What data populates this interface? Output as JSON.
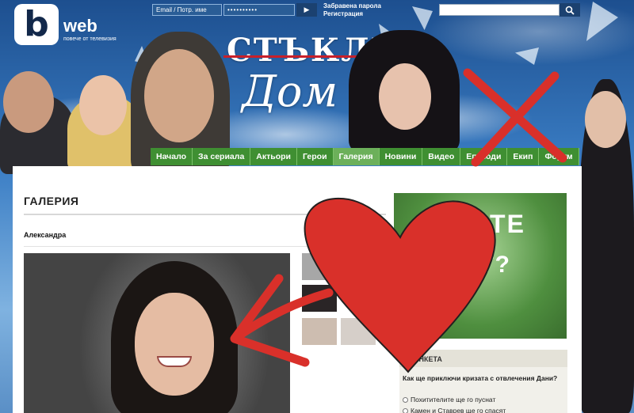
{
  "brand": {
    "logo_letter": "b",
    "logo_web": "web",
    "tagline": "повече от телевизия"
  },
  "login": {
    "username_placeholder": "Email / Потр. име",
    "password_value": "••••••••••",
    "forgot_label": "Забравена парола",
    "register_label": "Регистрация"
  },
  "search": {
    "placeholder": ""
  },
  "show": {
    "title_line1": "СТЪКЛЕН",
    "title_line2": "Дом"
  },
  "nav": {
    "items": [
      {
        "label": "Начало"
      },
      {
        "label": "За сериала"
      },
      {
        "label": "Актьори"
      },
      {
        "label": "Герои"
      },
      {
        "label": "Галерия"
      },
      {
        "label": "Новини"
      },
      {
        "label": "Видео"
      },
      {
        "label": "Епизоди"
      },
      {
        "label": "Екип"
      },
      {
        "label": "Форум"
      }
    ],
    "active_index": 4
  },
  "gallery": {
    "title": "ГАЛЕРИЯ",
    "photo_caption": "Александра"
  },
  "ad": {
    "line1": "ИКАТЕ",
    "line2": "ОСТ?"
  },
  "poll": {
    "title": "АНКЕТА",
    "question": "Как ще приключи кризата с отвлечения Дани?",
    "options": [
      {
        "label": "Похитителите ще го пуснат"
      },
      {
        "label": "Камен и Ставрев ще го спасят"
      }
    ]
  },
  "colors": {
    "nav_green": "#3f8f32",
    "nav_active": "#6cb05a",
    "doodle_red": "#d9302a"
  }
}
